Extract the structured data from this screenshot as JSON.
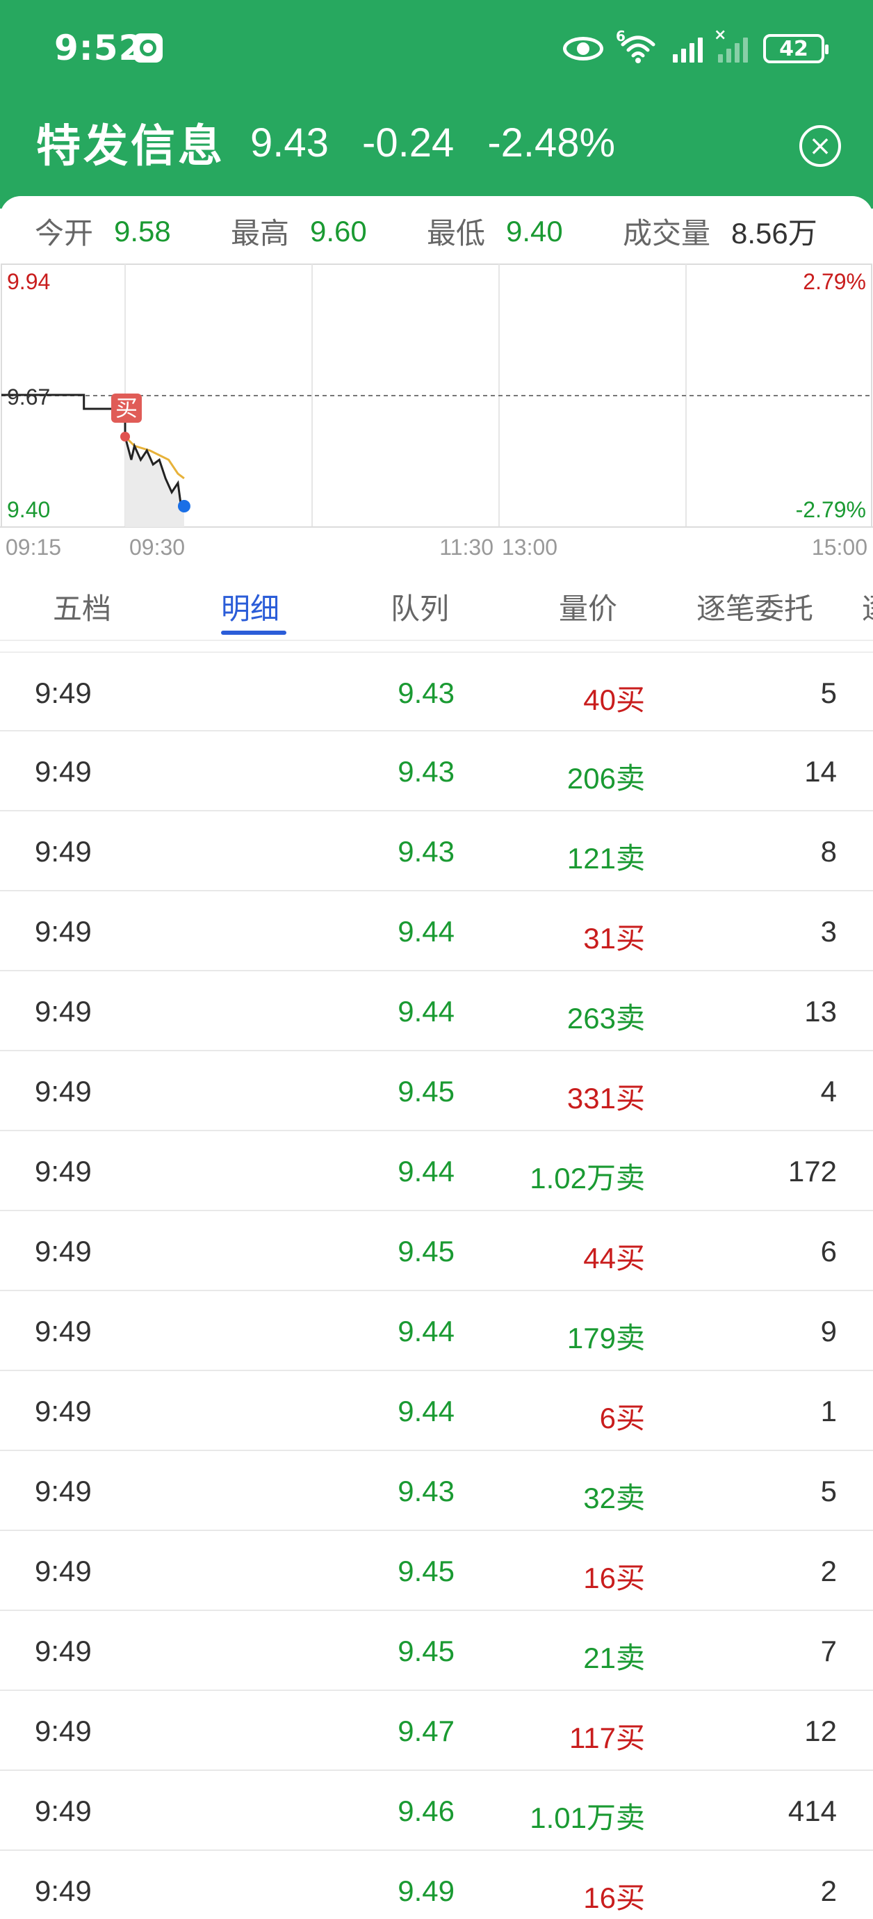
{
  "status_bar": {
    "time": "9:52",
    "battery": "42",
    "wifi_tag": "6"
  },
  "header": {
    "stock_name": "特发信息",
    "price": "9.43",
    "change": "-0.24",
    "change_pct": "-2.48%"
  },
  "stats": {
    "open_label": "今开",
    "open": "9.58",
    "high_label": "最高",
    "high": "9.60",
    "low_label": "最低",
    "low": "9.40",
    "volume_label": "成交量",
    "volume": "8.56万"
  },
  "chart": {
    "y_top": "9.94",
    "y_mid": "9.67",
    "y_bottom": "9.40",
    "pct_top": "2.79%",
    "pct_bottom": "-2.79%",
    "x_labels": [
      "09:15",
      "09:30",
      "11:30",
      "13:00",
      "15:00"
    ],
    "buy_marker": "买"
  },
  "chart_data": {
    "type": "line",
    "ylim": [
      9.4,
      9.94
    ],
    "reference": 9.67,
    "pct_range": [
      "-2.79%",
      "2.79%"
    ],
    "x_ticks": [
      "09:15",
      "09:30",
      "11:30",
      "13:00",
      "15:00"
    ],
    "price_series": [
      {
        "t": "09:15",
        "v": 9.67
      },
      {
        "t": "09:25",
        "v": 9.67
      },
      {
        "t": "09:25",
        "v": 9.64
      },
      {
        "t": "09:30",
        "v": 9.64
      },
      {
        "t": "09:30",
        "v": 9.58
      },
      {
        "t": "09:32",
        "v": 9.53
      },
      {
        "t": "09:33",
        "v": 9.56
      },
      {
        "t": "09:35",
        "v": 9.53
      },
      {
        "t": "09:37",
        "v": 9.55
      },
      {
        "t": "09:39",
        "v": 9.52
      },
      {
        "t": "09:41",
        "v": 9.53
      },
      {
        "t": "09:43",
        "v": 9.49
      },
      {
        "t": "09:45",
        "v": 9.46
      },
      {
        "t": "09:47",
        "v": 9.48
      },
      {
        "t": "09:48",
        "v": 9.43
      },
      {
        "t": "09:49",
        "v": 9.43
      }
    ],
    "avg_series": [
      {
        "t": "09:30",
        "v": 9.58
      },
      {
        "t": "09:33",
        "v": 9.56
      },
      {
        "t": "09:38",
        "v": 9.55
      },
      {
        "t": "09:44",
        "v": 9.53
      },
      {
        "t": "09:47",
        "v": 9.5
      },
      {
        "t": "09:49",
        "v": 9.49
      }
    ]
  },
  "tabs": [
    "五档",
    "明细",
    "队列",
    "量价",
    "逐笔委托",
    "逐"
  ],
  "active_tab": "明细",
  "trades": [
    {
      "time": "9:49",
      "price": "9.43",
      "vol": "40买",
      "side": "buy",
      "count": "5"
    },
    {
      "time": "9:49",
      "price": "9.43",
      "vol": "206卖",
      "side": "sell",
      "count": "14"
    },
    {
      "time": "9:49",
      "price": "9.43",
      "vol": "121卖",
      "side": "sell",
      "count": "8"
    },
    {
      "time": "9:49",
      "price": "9.44",
      "vol": "31买",
      "side": "buy",
      "count": "3"
    },
    {
      "time": "9:49",
      "price": "9.44",
      "vol": "263卖",
      "side": "sell",
      "count": "13"
    },
    {
      "time": "9:49",
      "price": "9.45",
      "vol": "331买",
      "side": "buy",
      "count": "4"
    },
    {
      "time": "9:49",
      "price": "9.44",
      "vol": "1.02万卖",
      "side": "sell",
      "count": "172"
    },
    {
      "time": "9:49",
      "price": "9.45",
      "vol": "44买",
      "side": "buy",
      "count": "6"
    },
    {
      "time": "9:49",
      "price": "9.44",
      "vol": "179卖",
      "side": "sell",
      "count": "9"
    },
    {
      "time": "9:49",
      "price": "9.44",
      "vol": "6买",
      "side": "buy",
      "count": "1"
    },
    {
      "time": "9:49",
      "price": "9.43",
      "vol": "32卖",
      "side": "sell",
      "count": "5"
    },
    {
      "time": "9:49",
      "price": "9.45",
      "vol": "16买",
      "side": "buy",
      "count": "2"
    },
    {
      "time": "9:49",
      "price": "9.45",
      "vol": "21卖",
      "side": "sell",
      "count": "7"
    },
    {
      "time": "9:49",
      "price": "9.47",
      "vol": "117买",
      "side": "buy",
      "count": "12"
    },
    {
      "time": "9:49",
      "price": "9.46",
      "vol": "1.01万卖",
      "side": "sell",
      "count": "414"
    },
    {
      "time": "9:49",
      "price": "9.49",
      "vol": "16买",
      "side": "buy",
      "count": "2"
    }
  ],
  "colors": {
    "header_green": "#27a85f",
    "up_red": "#c91d1d",
    "down_green": "#1a9a32",
    "active_blue": "#2b5dd8"
  }
}
